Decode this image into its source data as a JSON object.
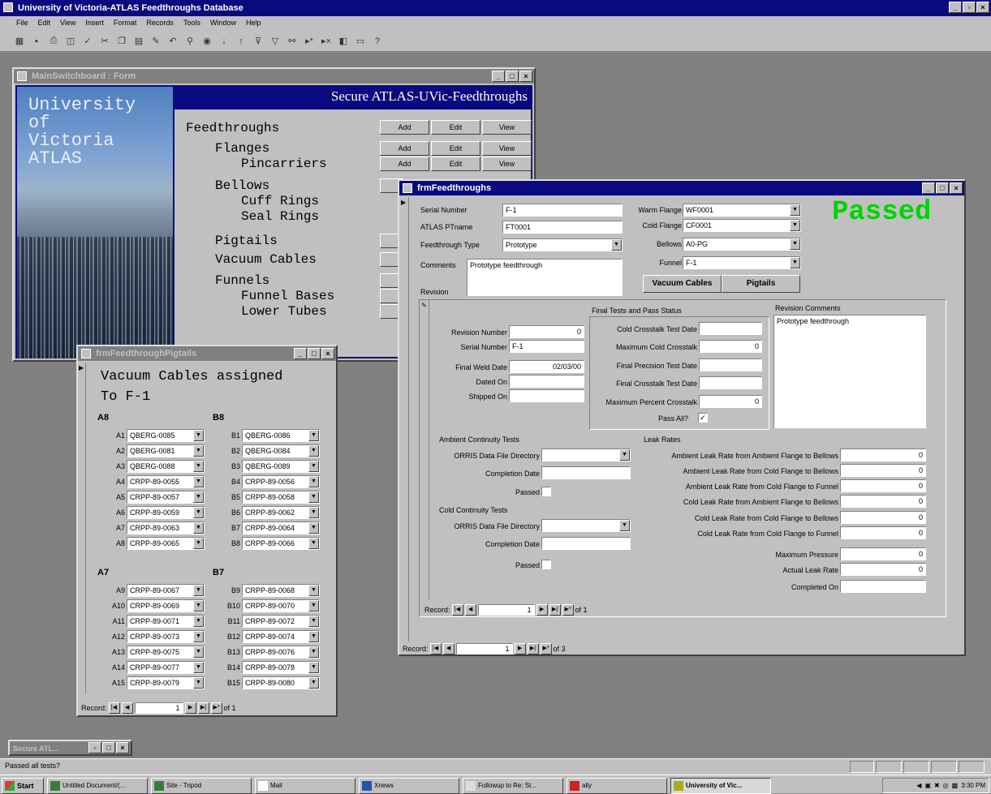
{
  "app": {
    "title": "University of Victoria-ATLAS Feedthroughs Database"
  },
  "menu": [
    "File",
    "Edit",
    "View",
    "Insert",
    "Format",
    "Records",
    "Tools",
    "Window",
    "Help"
  ],
  "switchboard": {
    "title": "MainSwitchboard : Form",
    "banner": "Secure ATLAS-UVic-Feedthroughs",
    "logo_lines": [
      "University",
      "of",
      "Victoria",
      "ATLAS"
    ],
    "items": [
      {
        "label": "Feedthroughs",
        "buttons": [
          "Add",
          "Edit",
          "View"
        ]
      },
      {
        "label": "Flanges",
        "buttons": [
          "Add",
          "Edit",
          "View"
        ]
      },
      {
        "label": "Pincarriers",
        "buttons": [
          "Add",
          "Edit",
          "View"
        ]
      },
      {
        "label": "Bellows"
      },
      {
        "label": "Cuff Rings"
      },
      {
        "label": "Seal Rings"
      },
      {
        "label": "Pigtails"
      },
      {
        "label": "Vacuum Cables"
      },
      {
        "label": "Funnels"
      },
      {
        "label": "Funnel Bases"
      },
      {
        "label": "Lower Tubes"
      }
    ]
  },
  "pigtails": {
    "title": "frmFeedthroughPigtails",
    "heading_line1": "Vacuum Cables assigned",
    "heading_line2": "To F-1",
    "groups": [
      {
        "name": "A8",
        "rows": [
          [
            "A1",
            "QBERG-0085"
          ],
          [
            "A2",
            "QBERG-0081"
          ],
          [
            "A3",
            "QBERG-0088"
          ],
          [
            "A4",
            "CRPP-89-0055"
          ],
          [
            "A5",
            "CRPP-89-0057"
          ],
          [
            "A6",
            "CRPP-89-0059"
          ],
          [
            "A7",
            "CRPP-89-0063"
          ],
          [
            "A8",
            "CRPP-89-0065"
          ]
        ]
      },
      {
        "name": "B8",
        "rows": [
          [
            "B1",
            "QBERG-0086"
          ],
          [
            "B2",
            "QBERG-0084"
          ],
          [
            "B3",
            "QBERG-0089"
          ],
          [
            "B4",
            "CRPP-89-0056"
          ],
          [
            "B5",
            "CRPP-89-0058"
          ],
          [
            "B6",
            "CRPP-89-0062"
          ],
          [
            "B7",
            "CRPP-89-0064"
          ],
          [
            "B8",
            "CRPP-89-0066"
          ]
        ]
      },
      {
        "name": "A7",
        "rows": [
          [
            "A9",
            "CRPP-89-0067"
          ],
          [
            "A10",
            "CRPP-89-0069"
          ],
          [
            "A11",
            "CRPP-89-0071"
          ],
          [
            "A12",
            "CRPP-89-0073"
          ],
          [
            "A13",
            "CRPP-89-0075"
          ],
          [
            "A14",
            "CRPP-89-0077"
          ],
          [
            "A15",
            "CRPP-89-0079"
          ]
        ]
      },
      {
        "name": "B7",
        "rows": [
          [
            "B9",
            "CRPP-89-0068"
          ],
          [
            "B10",
            "CRPP-89-0070"
          ],
          [
            "B11",
            "CRPP-89-0072"
          ],
          [
            "B12",
            "CRPP-89-0074"
          ],
          [
            "B13",
            "CRPP-89-0076"
          ],
          [
            "B14",
            "CRPP-89-0078"
          ],
          [
            "B15",
            "CRPP-89-0080"
          ]
        ]
      }
    ],
    "record_label": "Record:",
    "record_num": "1",
    "record_of": "of 1"
  },
  "feedthroughs": {
    "title": "frmFeedthroughs",
    "status": "Passed",
    "serial_label": "Serial Number",
    "serial": "F-1",
    "atlas_label": "ATLAS PTname",
    "atlas": "FT0001",
    "type_label": "Feedthrough Type",
    "type": "Prototype",
    "comments_label": "Comments",
    "comments": "Prototype feedthrough",
    "revision_label": "Revision",
    "warm_label": "Warm Flange",
    "warm": "WF0001",
    "cold_label": "Cold Flange",
    "cold": "CF0001",
    "bellows_label": "Bellows",
    "bellows": "A0-PG",
    "funnel_label": "Funnel",
    "funnel": "F-1",
    "vacuum_btn": "Vacuum Cables",
    "pigtails_btn": "Pigtails",
    "rev": {
      "revnum_label": "Revision Number",
      "revnum": "0",
      "serial_label": "Serial Number",
      "serial": "F-1",
      "weld_label": "Final Weld Date",
      "weld": "02/03/00",
      "dated_label": "Dated On",
      "shipped_label": "Shipped On",
      "final_tests_title": "Final Tests and Pass Status",
      "cold_xtalk_date_label": "Cold Crosstalk Test Date",
      "max_cold_xtalk_label": "Maximum Cold Crosstalk",
      "max_cold_xtalk": "0",
      "final_precision_label": "Final Precision Test Date",
      "final_xtalk_label": "Final Crosstalk Test Date",
      "max_pct_xtalk_label": "Maximum Percent Crosstalk",
      "max_pct_xtalk": "0",
      "pass_all_label": "Pass All?",
      "rev_comments_title": "Revision Comments",
      "rev_comments": "Prototype feedthrough",
      "ambient_title": "Ambient Continuity Tests",
      "orris_label": "ORRIS Data File Directory",
      "completion_label": "Completion Date",
      "passed_label": "Passed",
      "cold_title": "Cold Continuity Tests",
      "leak_title": "Leak Rates",
      "leaks": [
        [
          "Ambient Leak Rate from Ambient Flange to Bellows",
          "0"
        ],
        [
          "Ambient Leak Rate from Cold Flange to Bellows",
          "0"
        ],
        [
          "Ambient Leak Rate from Cold Flange to Funnel",
          "0"
        ],
        [
          "Cold Leak Rate from Ambient Flange to Bellows",
          "0"
        ],
        [
          "Cold Leak Rate from Cold Flange to Bellows",
          "0"
        ],
        [
          "Cold Leak Rate from Cold Flange to Funnel",
          "0"
        ]
      ],
      "max_pressure_label": "Maximum Pressure",
      "max_pressure": "0",
      "actual_leak_label": "Actual Leak Rate",
      "actual_leak": "0",
      "completed_on_label": "Completed On",
      "record_num": "1",
      "record_of": "of 1"
    },
    "record_label": "Record:",
    "record_num": "1",
    "record_of": "of 3"
  },
  "minimized": {
    "label": "Secure ATL..."
  },
  "statusbar": "Passed all tests?",
  "taskbar": {
    "start": "Start",
    "tasks": [
      "Untitled Document/(...",
      "Site - Tripod",
      "Mail",
      "Xnews",
      "Followup to Re: St...",
      "ally",
      "University of Vic..."
    ],
    "clock": "3:30 PM"
  }
}
